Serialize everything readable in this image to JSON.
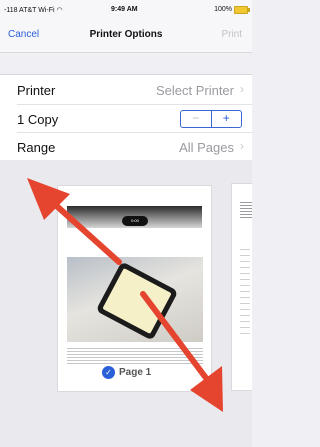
{
  "status_bar": {
    "carrier": "-118 AT&T Wi-Fi",
    "time": "9:49 AM",
    "battery": "100%"
  },
  "nav": {
    "cancel_label": "Cancel",
    "title": "Printer Options",
    "print_label": "Print"
  },
  "options": {
    "printer": {
      "label": "Printer",
      "value": "Select Printer"
    },
    "copies": {
      "label": "1 Copy",
      "minus": "−",
      "plus": "+"
    },
    "range": {
      "label": "Range",
      "value": "All Pages"
    }
  },
  "preview": {
    "page_label": "Page 1",
    "mini_pill": "0:00"
  },
  "colors": {
    "accent": "#2a5fd8",
    "arrow": "#e5452f"
  },
  "icons": {
    "chevron": "chevron-right-icon",
    "wifi": "wifi-icon",
    "battery": "battery-icon",
    "check": "checkmark-icon"
  }
}
